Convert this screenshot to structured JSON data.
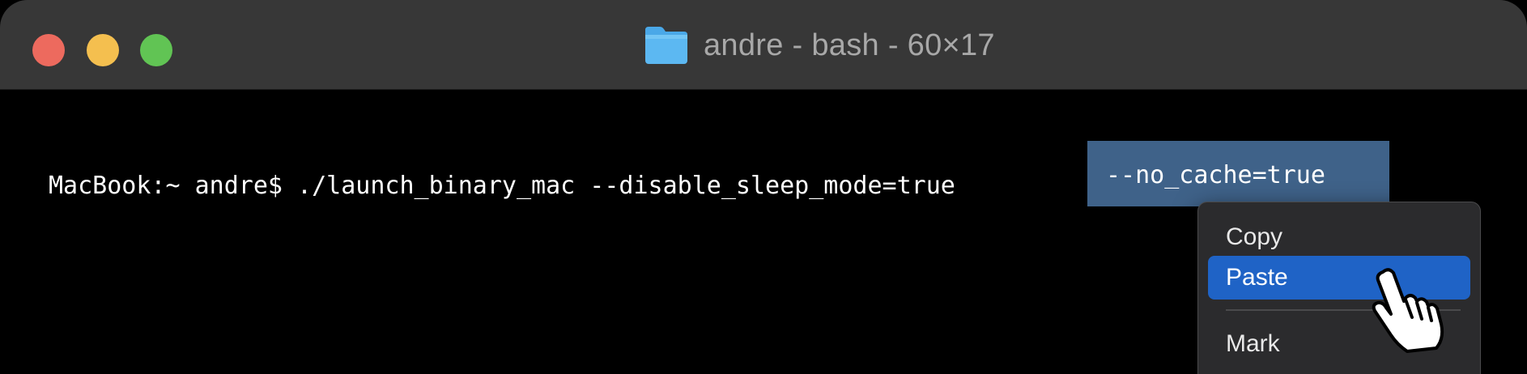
{
  "window": {
    "title": "andre - bash - 60×17",
    "folder_icon": "folder-icon"
  },
  "terminal": {
    "prompt_text": "MacBook:~ andre$ ./launch_binary_mac --disable_sleep_mode=true",
    "selected_text": "--no_cache=true"
  },
  "context_menu": {
    "items": [
      {
        "label": "Copy"
      },
      {
        "label": "Paste",
        "highlighted": true
      },
      {
        "label": "Mark"
      }
    ]
  },
  "colors": {
    "titlebar": "#373737",
    "selection": "#3f6289",
    "menu_highlight": "#1f63c6",
    "close": "#ed6a5e",
    "minimize": "#f4bf4f",
    "zoom": "#61c454"
  },
  "cursor": {
    "icon": "pointing-hand-cursor-icon"
  }
}
